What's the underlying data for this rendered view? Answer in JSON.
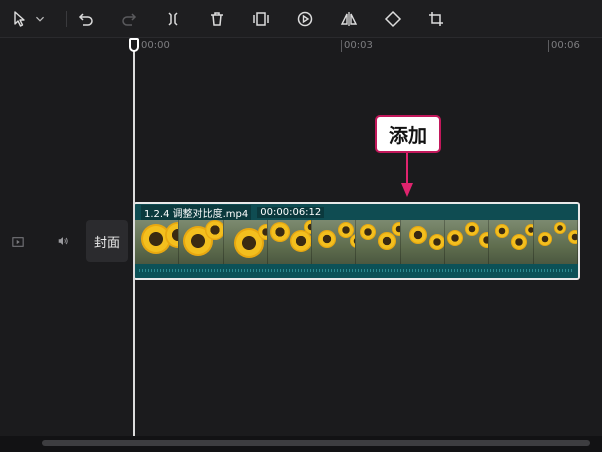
{
  "toolbar": {
    "tools": [
      {
        "icon": "select-pointer-icon",
        "label": "select"
      },
      {
        "icon": "dropdown-chevron-icon",
        "label": "select-mode"
      },
      {
        "icon": "undo-icon",
        "label": "undo"
      },
      {
        "icon": "redo-icon",
        "label": "redo"
      },
      {
        "icon": "split-icon",
        "label": "split"
      },
      {
        "icon": "delete-icon",
        "label": "delete"
      },
      {
        "icon": "freeze-frame-icon",
        "label": "freeze"
      },
      {
        "icon": "reverse-play-icon",
        "label": "reverse"
      },
      {
        "icon": "mirror-icon",
        "label": "mirror"
      },
      {
        "icon": "rotate-icon",
        "label": "rotate"
      },
      {
        "icon": "crop-icon",
        "label": "crop"
      }
    ]
  },
  "ruler": {
    "labels": [
      "00:00",
      "00:03",
      "00:06"
    ]
  },
  "track": {
    "cover_label": "封面",
    "video_icon": "video-track-icon",
    "audio_icon": "speaker-icon"
  },
  "clip": {
    "name": "1.2.4  调整对比度.mp4",
    "duration": "00:00:06:12",
    "thumbnail_count": 10
  },
  "annotation": {
    "text": "添加"
  },
  "colors": {
    "clip_fill": "#0f5a60",
    "callout_border": "#c2185b",
    "arrow": "#e0246e"
  }
}
